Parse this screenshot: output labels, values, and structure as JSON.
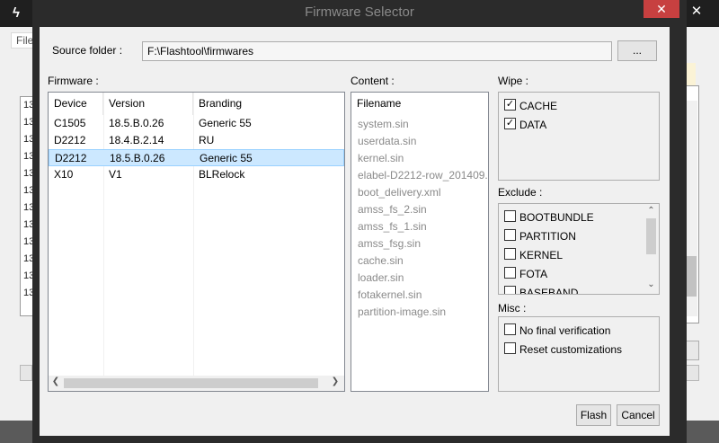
{
  "background": {
    "menu_label": "File",
    "log_lines": [
      "13",
      "13",
      "13",
      "13",
      "13",
      "13",
      "13",
      "13",
      "13",
      "13",
      "13",
      "13"
    ]
  },
  "dialog": {
    "title": "Firmware Selector",
    "close_glyph": "✕",
    "source_folder_label": "Source folder :",
    "source_folder_value": "F:\\Flashtool\\firmwares",
    "browse_label": "...",
    "firmware_label": "Firmware :",
    "content_label": "Content :",
    "wipe_label": "Wipe :",
    "exclude_label": "Exclude :",
    "misc_label": "Misc :",
    "flash_label": "Flash",
    "cancel_label": "Cancel"
  },
  "firmware_table": {
    "headers": [
      "Device",
      "Version",
      "Branding"
    ],
    "rows": [
      {
        "device": "C1505",
        "version": "18.5.B.0.26",
        "branding": "Generic 55",
        "selected": false
      },
      {
        "device": "D2212",
        "version": "18.4.B.2.14",
        "branding": "RU",
        "selected": false
      },
      {
        "device": "D2212",
        "version": "18.5.B.0.26",
        "branding": "Generic 55",
        "selected": true
      },
      {
        "device": "X10",
        "version": "V1",
        "branding": "BLRelock",
        "selected": false
      }
    ]
  },
  "content_list": {
    "header": "Filename",
    "items": [
      "system.sin",
      "userdata.sin",
      "kernel.sin",
      "elabel-D2212-row_201409...",
      "boot_delivery.xml",
      "amss_fs_2.sin",
      "amss_fs_1.sin",
      "amss_fsg.sin",
      "cache.sin",
      "loader.sin",
      "fotakernel.sin",
      "partition-image.sin"
    ]
  },
  "wipe": [
    {
      "label": "CACHE",
      "checked": true
    },
    {
      "label": "DATA",
      "checked": true
    }
  ],
  "exclude": [
    {
      "label": "BOOTBUNDLE",
      "checked": false
    },
    {
      "label": "PARTITION",
      "checked": false
    },
    {
      "label": "KERNEL",
      "checked": false
    },
    {
      "label": "FOTA",
      "checked": false
    },
    {
      "label": "BASEBAND",
      "checked": false
    }
  ],
  "misc": [
    {
      "label": "No final verification",
      "checked": false
    },
    {
      "label": "Reset customizations",
      "checked": false
    }
  ],
  "colors": {
    "selected_row": "#cce8ff",
    "close_button": "#c74040",
    "dialog_frame": "#2b2b2b"
  }
}
